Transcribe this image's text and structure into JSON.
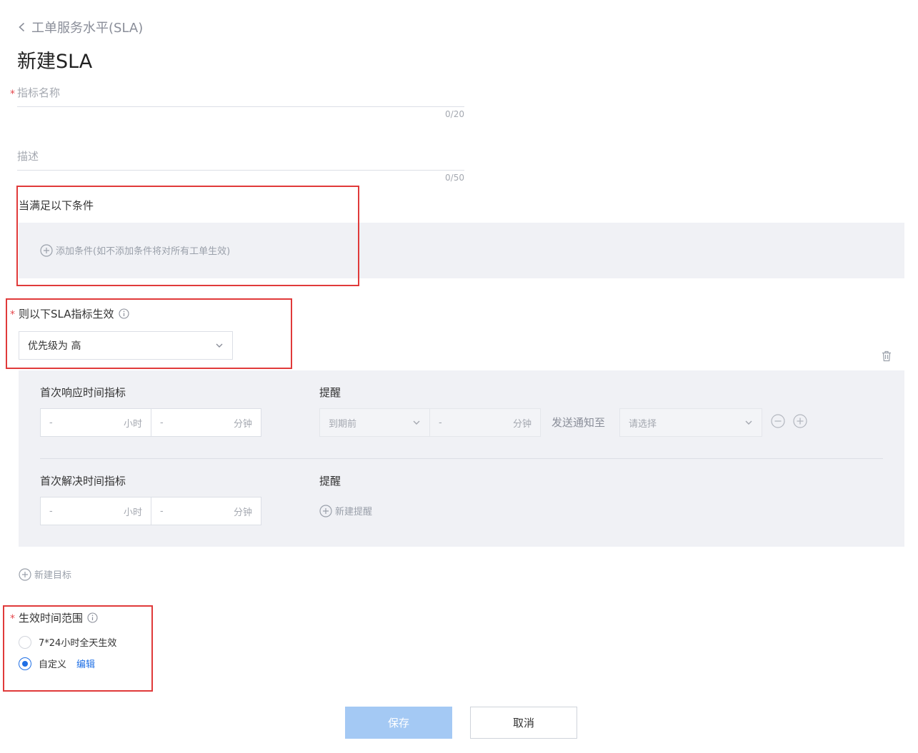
{
  "breadcrumb": {
    "back_label": "工单服务水平(SLA)"
  },
  "page": {
    "title": "新建SLA"
  },
  "form": {
    "name": {
      "required_mark": "*",
      "placeholder": "指标名称",
      "counter": "0/20"
    },
    "description": {
      "placeholder": "描述",
      "counter": "0/50"
    },
    "conditions": {
      "label": "当满足以下条件",
      "add_label": "添加条件(如不添加条件将对所有工单生效)"
    },
    "sla_target": {
      "required_mark": "*",
      "label": "则以下SLA指标生效",
      "selected": "优先级为 高",
      "first_response": {
        "label": "首次响应时间指标",
        "hours_value": "-",
        "hours_unit": "小时",
        "minutes_value": "-",
        "minutes_unit": "分钟",
        "reminder_label": "提醒",
        "reminder_when": "到期前",
        "reminder_minutes_value": "-",
        "reminder_minutes_unit": "分钟",
        "notify_label": "发送通知至",
        "notify_placeholder": "请选择"
      },
      "first_resolve": {
        "label": "首次解决时间指标",
        "hours_value": "-",
        "hours_unit": "小时",
        "minutes_value": "-",
        "minutes_unit": "分钟",
        "reminder_label": "提醒",
        "add_reminder": "新建提醒"
      },
      "add_target": "新建目标"
    },
    "effective_time": {
      "required_mark": "*",
      "label": "生效时间范围",
      "options": [
        {
          "label": "7*24小时全天生效",
          "checked": false
        },
        {
          "label": "自定义",
          "checked": true
        }
      ],
      "edit_label": "编辑"
    }
  },
  "actions": {
    "save": "保存",
    "cancel": "取消"
  },
  "colors": {
    "accent": "#1f6fe5",
    "save_disabled": "#a4c9f4",
    "highlight": "#e03a3a",
    "required": "#e5484d"
  }
}
